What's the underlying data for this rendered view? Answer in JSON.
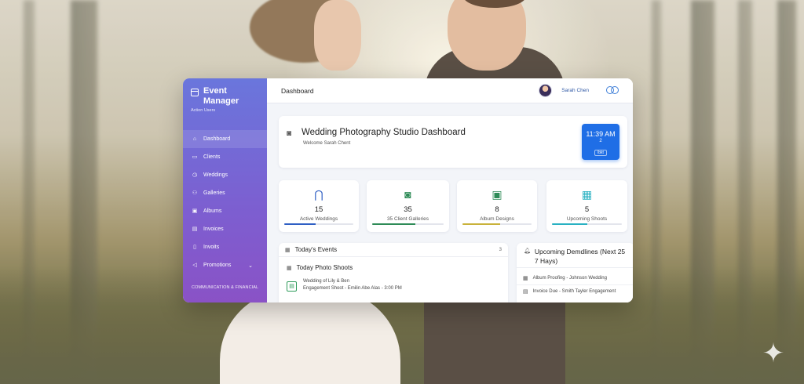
{
  "sidebar": {
    "brand_title": "Event Manager",
    "brand_sub": "Action Users",
    "items": [
      {
        "label": "Dashboard",
        "icon": "home-icon"
      },
      {
        "label": "Clients",
        "icon": "folder-icon"
      },
      {
        "label": "Weddings",
        "icon": "clock-icon"
      },
      {
        "label": "Galleries",
        "icon": "users-icon"
      },
      {
        "label": "Albums",
        "icon": "album-icon"
      },
      {
        "label": "Invoices",
        "icon": "invoice-icon"
      },
      {
        "label": "Invoits",
        "icon": "document-icon"
      },
      {
        "label": "Promotions",
        "icon": "megaphone-icon"
      }
    ],
    "footer": "COMMUNICATION & FINANCIAL"
  },
  "topbar": {
    "title": "Dashboard",
    "user_name": "Sarah Chen"
  },
  "hero": {
    "title": "Wedding Photography Studio Dashboard",
    "welcome": "Welcome  Sarah Chent",
    "clock_time": "11:39 AM",
    "clock_day": "2",
    "clock_mini": "lbkt"
  },
  "stats": [
    {
      "value": "15",
      "label": "Active Weddings",
      "icon": "rings-icon",
      "color": "#2f5fc4",
      "progress": 0.45
    },
    {
      "value": "35",
      "label": "35 Client Galleries",
      "icon": "camera-icon",
      "color": "#2e8b57",
      "progress": 0.6
    },
    {
      "value": "8",
      "label": "Album Designs",
      "icon": "album-icon",
      "color": "#c9b23a",
      "progress": 0.55
    },
    {
      "value": "5",
      "label": "Upcoming Shoots",
      "icon": "calendar-icon",
      "color": "#29b1c2",
      "progress": 0.5
    }
  ],
  "events": {
    "title": "Today's Events",
    "count": "3",
    "subtitle": "Today Photo Shoots",
    "item_title": "Wedding of Lily & Ben",
    "item_detail": "Engagement Shoot - Emilin Abe Alas - 3:00 PM"
  },
  "deadlines": {
    "title": "Upcoming Demdlines (Next 25 7 Hays)",
    "items": [
      "Album Proofing - Johnson Wedding",
      "Invoice Due - Smith Tayler Engagement"
    ]
  }
}
